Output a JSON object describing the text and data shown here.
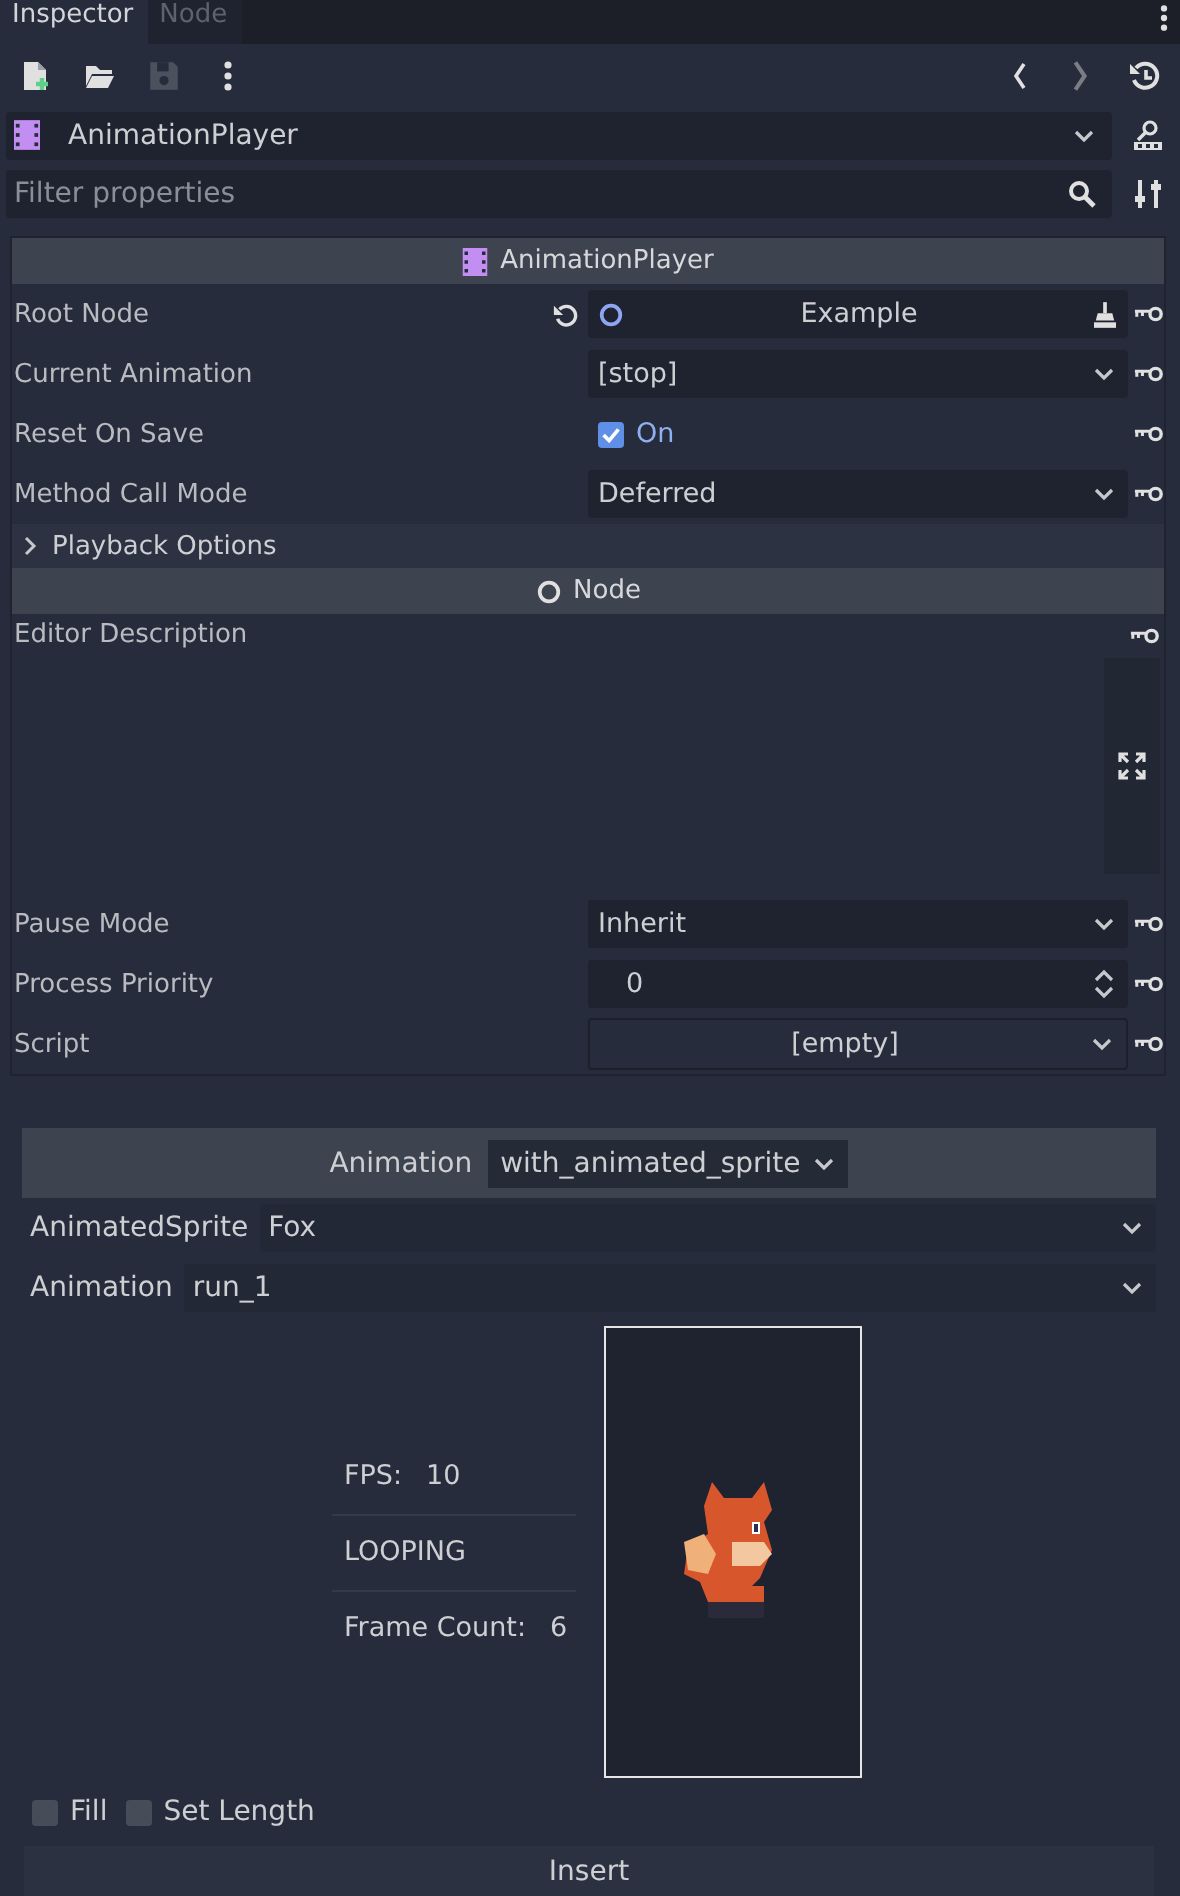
{
  "tabs": [
    {
      "label": "Inspector",
      "selected": true
    },
    {
      "label": "Node",
      "selected": false
    }
  ],
  "toolbar": {
    "left": [
      {
        "kind": "new",
        "disabled": false
      },
      {
        "kind": "open",
        "disabled": false
      },
      {
        "kind": "save",
        "disabled": true
      },
      {
        "kind": "more",
        "disabled": false
      }
    ],
    "right": [
      {
        "kind": "back",
        "disabled": false
      },
      {
        "kind": "forward",
        "disabled": true
      },
      {
        "kind": "history",
        "disabled": false
      }
    ]
  },
  "object_selector": {
    "value": "AnimationPlayer"
  },
  "filter": {
    "placeholder": "Filter properties"
  },
  "inspector": [
    {
      "kind": "category",
      "title": "AnimationPlayer"
    },
    {
      "kind": "node_path",
      "label": "Root Node",
      "value": "Example",
      "revertable": true
    },
    {
      "kind": "dropdown",
      "label": "Current Animation",
      "value": "[stop]"
    },
    {
      "kind": "checkbox",
      "label": "Reset On Save",
      "checked": true,
      "value": "On"
    },
    {
      "kind": "dropdown",
      "label": "Method Call Mode",
      "value": "Deferred"
    },
    {
      "kind": "group",
      "title": "Playback Options",
      "expanded": false
    },
    {
      "kind": "category",
      "title": "Node"
    },
    {
      "kind": "text_area",
      "label": "Editor Description"
    },
    {
      "kind": "dropdown",
      "label": "Pause Mode",
      "value": "Inherit"
    },
    {
      "kind": "spin",
      "label": "Process Priority",
      "value": "0"
    },
    {
      "kind": "resource",
      "label": "Script",
      "value": "[empty]"
    }
  ],
  "animation_panel": {
    "label": "Animation",
    "value": "with_animated_sprite",
    "rows": [
      {
        "label": "AnimatedSprite",
        "value": "Fox"
      },
      {
        "label": "Animation",
        "value": "run_1"
      }
    ],
    "info": [
      {
        "label": "FPS:",
        "value": "10"
      },
      {
        "label": "LOOPING"
      },
      {
        "label": "Frame Count:",
        "value": "6"
      }
    ],
    "options": [
      {
        "label": "Fill",
        "checked": false
      },
      {
        "label": "Set Length",
        "checked": false
      }
    ],
    "insert_button": "Insert"
  }
}
